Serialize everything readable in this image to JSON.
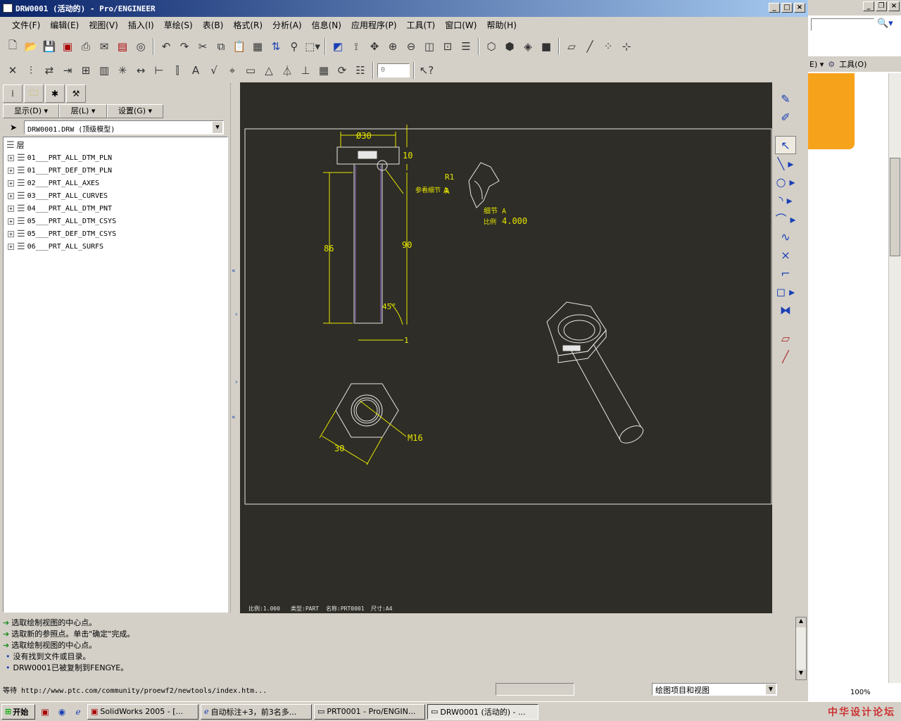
{
  "window": {
    "title": "DRW0001 (活动的) - Pro/ENGINEER"
  },
  "menu": [
    "文件(F)",
    "编辑(E)",
    "视图(V)",
    "插入(I)",
    "草绘(S)",
    "表(B)",
    "格式(R)",
    "分析(A)",
    "信息(N)",
    "应用程序(P)",
    "工具(T)",
    "窗口(W)",
    "帮助(H)"
  ],
  "left_panel": {
    "tabs": {
      "display": "显示(D)",
      "layer": "层(L)",
      "settings": "设置(G)"
    },
    "model_select": "DRW0001.DRW (顶级模型)",
    "root": "层",
    "layers": [
      "01___PRT_ALL_DTM_PLN",
      "01___PRT_DEF_DTM_PLN",
      "02___PRT_ALL_AXES",
      "03___PRT_ALL_CURVES",
      "04___PRT_ALL_DTM_PNT",
      "05___PRT_ALL_DTM_CSYS",
      "05___PRT_DEF_DTM_CSYS",
      "06___PRT_ALL_SURFS"
    ]
  },
  "drawing": {
    "dim_phi30": "Ø30",
    "dim_10": "10",
    "dim_86": "86",
    "dim_90": "90",
    "dim_45": "45°",
    "dim_1": "1",
    "detail_ref": "参看细节",
    "detail_ref_letter": "A",
    "detail_r1": "R1",
    "detail_a": "A",
    "detail_label": "细节 A",
    "detail_scale_label": "比例",
    "detail_scale": "4.000",
    "dim_30": "30",
    "dim_m16": "M16",
    "footer_scale": "比例:1.000",
    "footer_type": "类型:PART",
    "footer_name": "名称:PRT0001",
    "footer_size": "尺寸:A4"
  },
  "messages": [
    {
      "type": "prompt",
      "text": "选取绘制视图的中心点。"
    },
    {
      "type": "prompt",
      "text": "选取新的参照点。单击\"确定\"完成。"
    },
    {
      "type": "prompt",
      "text": "选取绘制视图的中心点。"
    },
    {
      "type": "info",
      "text": "没有找到文件或目录。"
    },
    {
      "type": "info",
      "text": "DRW0001已被复制到FENGYE。"
    }
  ],
  "status": {
    "text": "等待 http://www.ptc.com/community/proewf2/newtools/index.htm...",
    "filter": "绘图项目和视图"
  },
  "toolbar2": {
    "spin_value": "0"
  },
  "taskbar": {
    "start": "开始",
    "tasks": [
      "SolidWorks 2005 - [...",
      "自动标注+3，前3名多...",
      "PRT0001 - Pro/ENGIN...",
      "DRW0001 (活动的) - ..."
    ],
    "tray_text": "中华设计论坛"
  },
  "bg_window": {
    "menu_suffix": "E) ▾",
    "tools": "工具(O)",
    "zoom": "100%"
  }
}
